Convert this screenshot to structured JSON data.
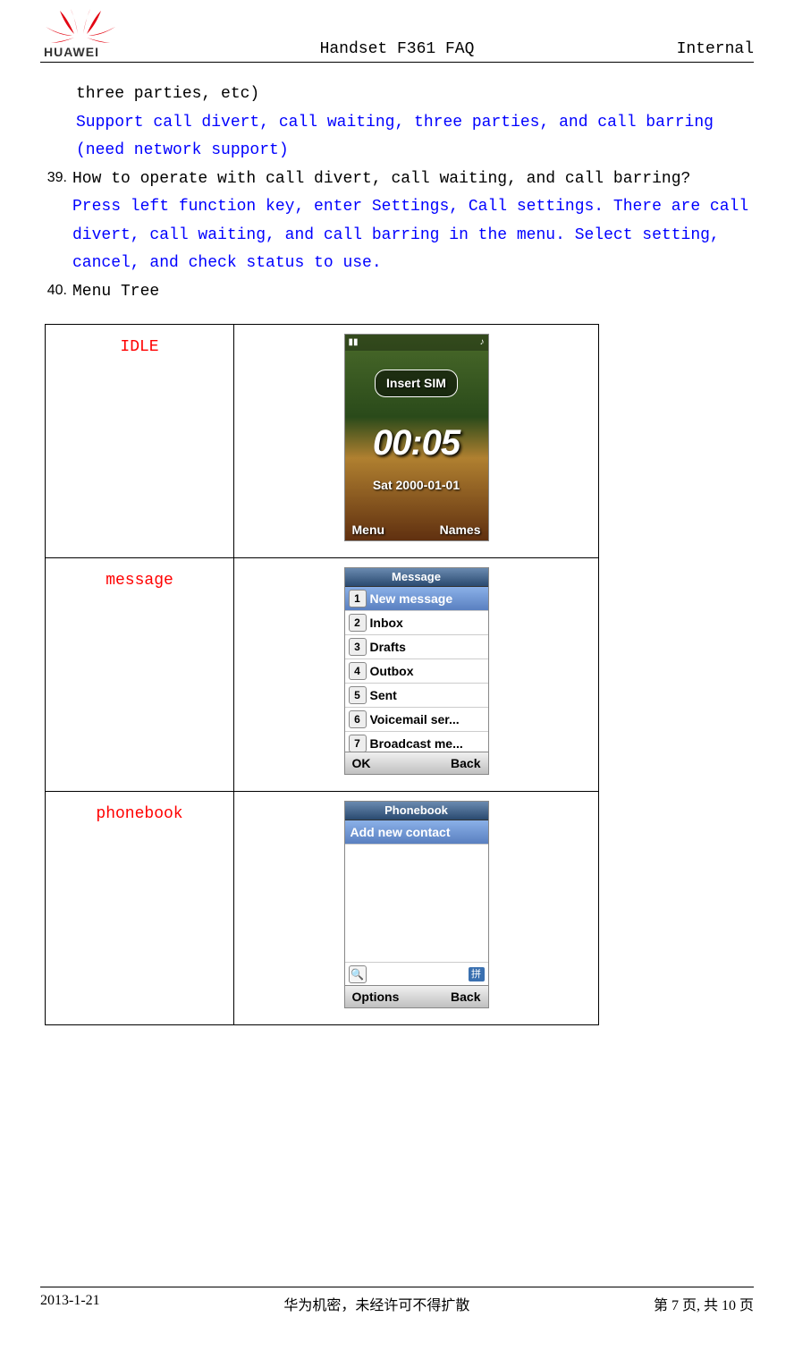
{
  "header": {
    "center": "Handset F361  FAQ",
    "right": "Internal"
  },
  "body": {
    "line_cont": "three parties, etc)",
    "line_blue1": "Support call divert, call waiting, three parties, and call barring (need network support)",
    "q39_num": "39.",
    "q39_text": "How to operate with call divert, call waiting, and call barring?",
    "q39_ans": "Press left function key, enter Settings, Call settings. There are call divert, call waiting, and call barring in the menu. Select setting, cancel, and check status to use.",
    "q40_num": "40.",
    "q40_text": "Menu Tree"
  },
  "table": {
    "rows": [
      {
        "label": "IDLE",
        "screen": {
          "type": "idle",
          "sim": "Insert SIM",
          "time": "00:05",
          "date": "Sat  2000-01-01",
          "soft_left": "Menu",
          "soft_right": "Names"
        }
      },
      {
        "label": "message",
        "screen": {
          "type": "list",
          "title": "Message",
          "items": [
            {
              "n": "1",
              "t": "New message",
              "sel": true
            },
            {
              "n": "2",
              "t": "Inbox"
            },
            {
              "n": "3",
              "t": "Drafts"
            },
            {
              "n": "4",
              "t": "Outbox"
            },
            {
              "n": "5",
              "t": "Sent"
            },
            {
              "n": "6",
              "t": "Voicemail ser..."
            },
            {
              "n": "7",
              "t": "Broadcast me..."
            }
          ],
          "soft_left": "OK",
          "soft_right": "Back"
        }
      },
      {
        "label": "phonebook",
        "screen": {
          "type": "phonebook",
          "title": "Phonebook",
          "item": "Add new contact",
          "pinyin": "拼",
          "soft_left": "Options",
          "soft_right": "Back"
        }
      }
    ]
  },
  "footer": {
    "left": "2013-1-21",
    "center": "华为机密，未经许可不得扩散",
    "right": "第 7 页, 共 10 页"
  }
}
